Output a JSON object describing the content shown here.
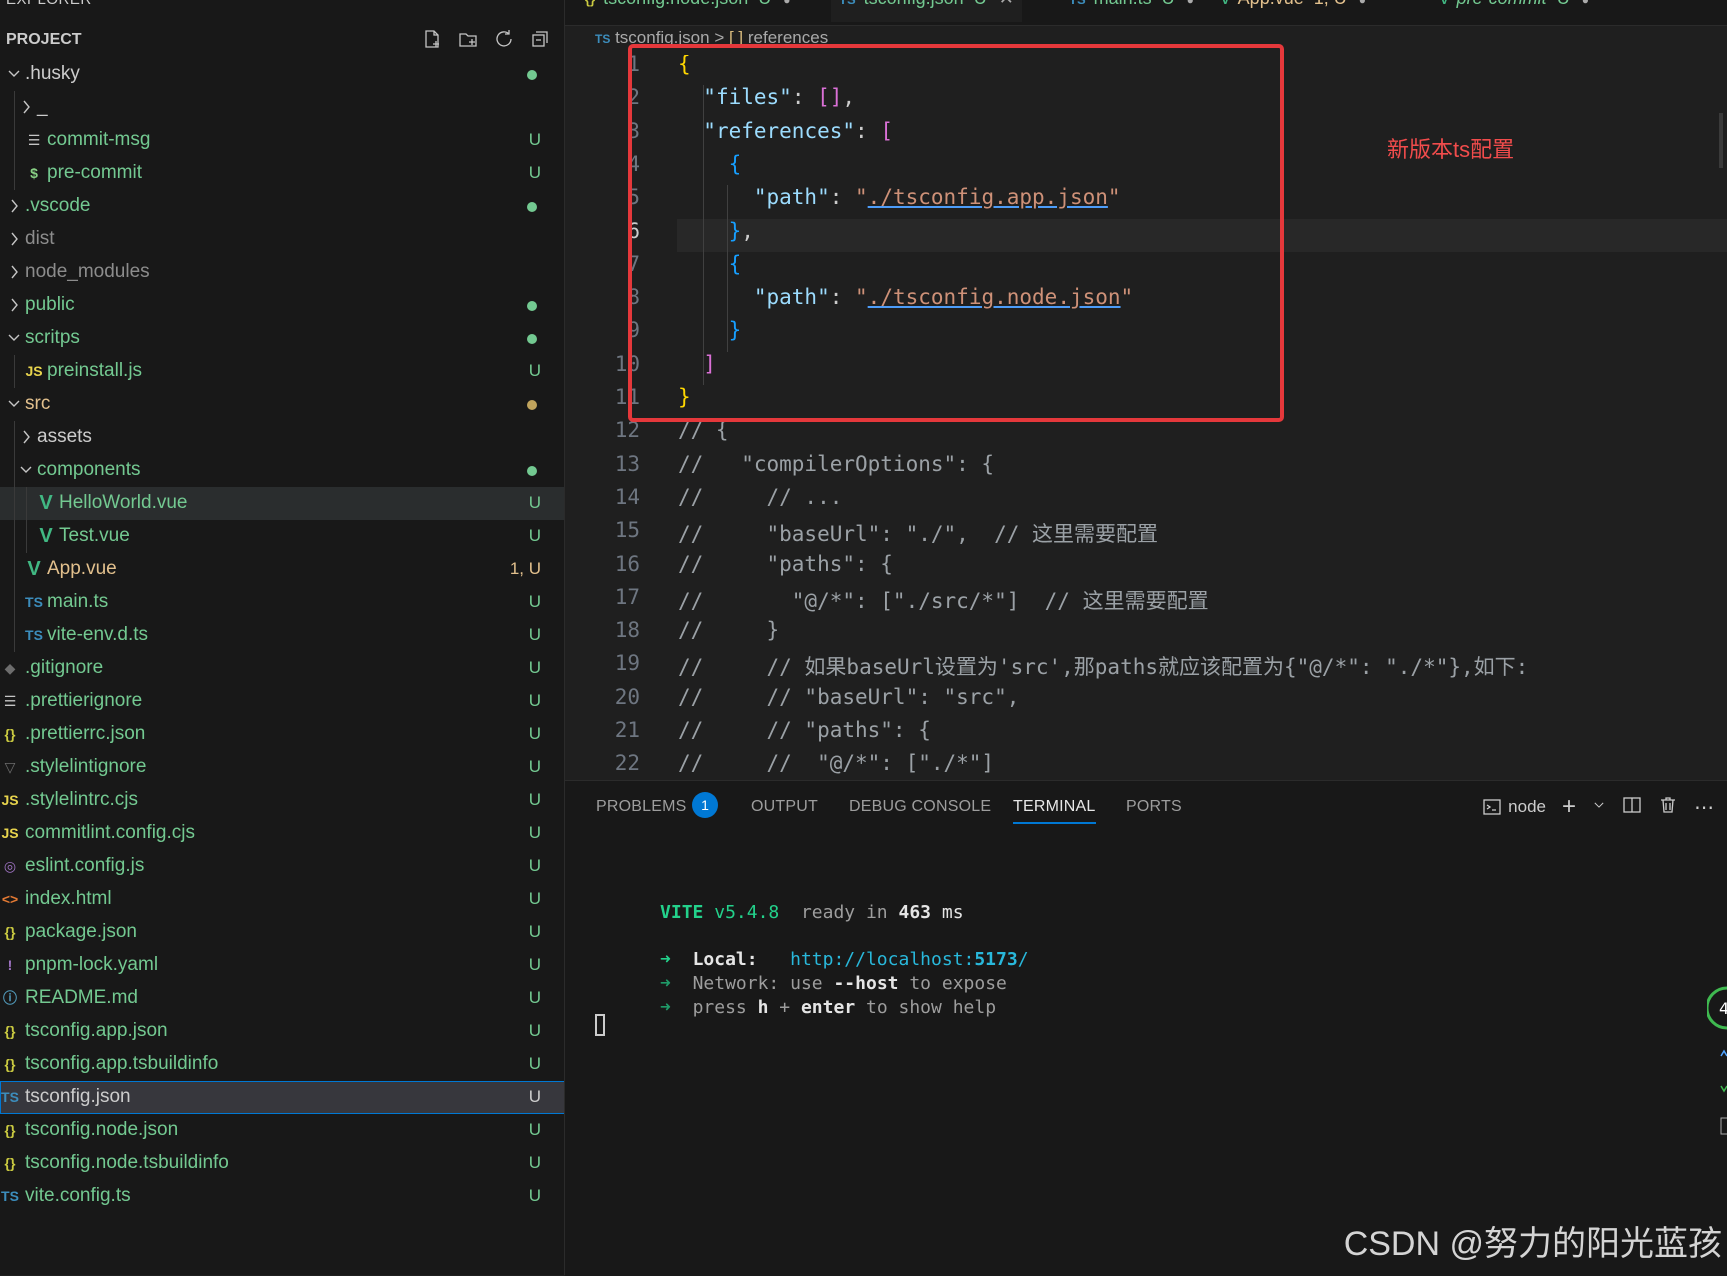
{
  "sidebar": {
    "section_title_cut": "EXPLORER",
    "project_title": "PROJECT",
    "actions": [
      "new-file",
      "new-folder",
      "refresh",
      "collapse-all"
    ],
    "tree": [
      {
        "label": ".husky",
        "kind": "folder-open",
        "depth": 0,
        "status": "",
        "dot": "#73c991",
        "color": "#cccccc"
      },
      {
        "label": "_",
        "kind": "folder-closed",
        "depth": 1,
        "status": "",
        "dot": "",
        "color": "#cccccc"
      },
      {
        "label": "commit-msg",
        "kind": "file-lines",
        "depth": 1,
        "status": "U",
        "color": "#73c991"
      },
      {
        "label": "pre-commit",
        "kind": "file-dollar",
        "depth": 1,
        "status": "U",
        "color": "#73c991"
      },
      {
        "label": ".vscode",
        "kind": "folder-closed",
        "depth": 0,
        "status": "",
        "dot": "#73c991",
        "color": "#73c991"
      },
      {
        "label": "dist",
        "kind": "folder-closed",
        "depth": 0,
        "status": "",
        "dot": "",
        "color": "#8c8c8c"
      },
      {
        "label": "node_modules",
        "kind": "folder-closed",
        "depth": 0,
        "status": "",
        "dot": "",
        "color": "#8c8c8c"
      },
      {
        "label": "public",
        "kind": "folder-closed",
        "depth": 0,
        "status": "",
        "dot": "#73c991",
        "color": "#73c991"
      },
      {
        "label": "scritps",
        "kind": "folder-open",
        "depth": 0,
        "status": "",
        "dot": "#73c991",
        "color": "#73c991"
      },
      {
        "label": "preinstall.js",
        "kind": "file-js",
        "depth": 1,
        "status": "U",
        "color": "#73c991"
      },
      {
        "label": "src",
        "kind": "folder-open",
        "depth": 0,
        "status": "",
        "dot": "#c1a45d",
        "color": "#e2c08d"
      },
      {
        "label": "assets",
        "kind": "folder-closed",
        "depth": 1,
        "status": "",
        "dot": "",
        "color": "#cccccc"
      },
      {
        "label": "components",
        "kind": "folder-open",
        "depth": 1,
        "status": "",
        "dot": "#73c991",
        "color": "#73c991"
      },
      {
        "label": "HelloWorld.vue",
        "kind": "file-vue",
        "depth": 2,
        "status": "U",
        "color": "#73c991",
        "hover": true
      },
      {
        "label": "Test.vue",
        "kind": "file-vue",
        "depth": 2,
        "status": "U",
        "color": "#73c991"
      },
      {
        "label": "App.vue",
        "kind": "file-vue",
        "depth": 1,
        "status": "1, U",
        "color": "#e2c08d"
      },
      {
        "label": "main.ts",
        "kind": "file-ts",
        "depth": 1,
        "status": "U",
        "color": "#73c991"
      },
      {
        "label": "vite-env.d.ts",
        "kind": "file-ts",
        "depth": 1,
        "status": "U",
        "color": "#73c991"
      },
      {
        "label": ".gitignore",
        "kind": "file-git",
        "depth": 0,
        "status": "U",
        "color": "#73c991"
      },
      {
        "label": ".prettierignore",
        "kind": "file-lines",
        "depth": 0,
        "status": "U",
        "color": "#73c991"
      },
      {
        "label": ".prettierrc.json",
        "kind": "file-json",
        "depth": 0,
        "status": "U",
        "color": "#73c991"
      },
      {
        "label": ".stylelintignore",
        "kind": "file-stylelint",
        "depth": 0,
        "status": "U",
        "color": "#73c991"
      },
      {
        "label": ".stylelintrc.cjs",
        "kind": "file-js",
        "depth": 0,
        "status": "U",
        "color": "#73c991"
      },
      {
        "label": "commitlint.config.cjs",
        "kind": "file-js",
        "depth": 0,
        "status": "U",
        "color": "#73c991"
      },
      {
        "label": "eslint.config.js",
        "kind": "file-eslint",
        "depth": 0,
        "status": "U",
        "color": "#73c991"
      },
      {
        "label": "index.html",
        "kind": "file-html",
        "depth": 0,
        "status": "U",
        "color": "#73c991"
      },
      {
        "label": "package.json",
        "kind": "file-json",
        "depth": 0,
        "status": "U",
        "color": "#73c991"
      },
      {
        "label": "pnpm-lock.yaml",
        "kind": "file-yaml",
        "depth": 0,
        "status": "U",
        "color": "#73c991"
      },
      {
        "label": "README.md",
        "kind": "file-info",
        "depth": 0,
        "status": "U",
        "color": "#73c991"
      },
      {
        "label": "tsconfig.app.json",
        "kind": "file-json",
        "depth": 0,
        "status": "U",
        "color": "#73c991"
      },
      {
        "label": "tsconfig.app.tsbuildinfo",
        "kind": "file-json",
        "depth": 0,
        "status": "U",
        "color": "#73c991"
      },
      {
        "label": "tsconfig.json",
        "kind": "file-tsconfig",
        "depth": 0,
        "status": "U",
        "color": "#cccccc",
        "selected": true
      },
      {
        "label": "tsconfig.node.json",
        "kind": "file-json",
        "depth": 0,
        "status": "U",
        "color": "#73c991"
      },
      {
        "label": "tsconfig.node.tsbuildinfo",
        "kind": "file-json",
        "depth": 0,
        "status": "U",
        "color": "#73c991"
      },
      {
        "label": "vite.config.ts",
        "kind": "file-ts",
        "depth": 0,
        "status": "U",
        "color": "#73c991"
      }
    ]
  },
  "tabs": [
    {
      "label": "tsconfig.node.json",
      "badge": "U",
      "icon": "{}",
      "active": false,
      "italic": false
    },
    {
      "label": "tsconfig.json",
      "badge": "U",
      "icon": "TS",
      "active": true,
      "italic": false
    },
    {
      "label": "main.ts",
      "badge": "U",
      "icon": "TS",
      "active": false,
      "italic": false
    },
    {
      "label": "App.vue",
      "badge": "1, U",
      "icon": "V",
      "active": false,
      "italic": false
    },
    {
      "label": "pre-commit",
      "badge": "U",
      "icon": "V",
      "active": false,
      "italic": true
    }
  ],
  "breadcrumb": {
    "file": "tsconfig.json",
    "sep": ">",
    "symbol_icon": "[ ]",
    "symbol": "references"
  },
  "editor": {
    "active_line": 6,
    "annotation": "新版本ts配置",
    "lines": [
      {
        "n": 1,
        "html": "<span class='p1'>{</span>"
      },
      {
        "n": 2,
        "html": "  <span class='k'>\"files\"</span>: <span class='p2'>[]</span>,"
      },
      {
        "n": 3,
        "html": "  <span class='k'>\"references\"</span>: <span class='p2'>[</span>"
      },
      {
        "n": 4,
        "html": "    <span class='p3'>{</span>"
      },
      {
        "n": 5,
        "html": "      <span class='k'>\"path\"</span>: <span class='s'>\"<span class='lnk'>./tsconfig.app.json</span>\"</span>"
      },
      {
        "n": 6,
        "html": "    <span class='p3'>}</span>,"
      },
      {
        "n": 7,
        "html": "    <span class='p3'>{</span>"
      },
      {
        "n": 8,
        "html": "      <span class='k'>\"path\"</span>: <span class='s'>\"<span class='lnk'>./tsconfig.node.json</span>\"</span>"
      },
      {
        "n": 9,
        "html": "    <span class='p3'>}</span>"
      },
      {
        "n": 10,
        "html": "  <span class='p2'>]</span>"
      },
      {
        "n": 11,
        "html": "<span class='p1'>}</span>"
      },
      {
        "n": 12,
        "html": "<span class='cm'>// {</span>"
      },
      {
        "n": 13,
        "html": "<span class='cm'>//   \"compilerOptions\": {</span>"
      },
      {
        "n": 14,
        "html": "<span class='cm'>//     // ...</span>"
      },
      {
        "n": 15,
        "html": "<span class='cm'>//     \"baseUrl\": \"./\",  // 这里需要配置</span>"
      },
      {
        "n": 16,
        "html": "<span class='cm'>//     \"paths\": {</span>"
      },
      {
        "n": 17,
        "html": "<span class='cm'>//       \"@/*\": [\"./src/*\"]  // 这里需要配置</span>"
      },
      {
        "n": 18,
        "html": "<span class='cm'>//     }</span>"
      },
      {
        "n": 19,
        "html": "<span class='cm'>//     // 如果baseUrl设置为'src',那paths就应该配置为{\"@/*\": \"./*\"},如下:</span>"
      },
      {
        "n": 20,
        "html": "<span class='cm'>//     // \"baseUrl\": \"src\",</span>"
      },
      {
        "n": 21,
        "html": "<span class='cm'>//     // \"paths\": {</span>"
      },
      {
        "n": 22,
        "html": "<span class='cm'>//     //  \"@/*\": [\"./*\"]</span>"
      }
    ]
  },
  "panel": {
    "tabs": [
      "PROBLEMS",
      "OUTPUT",
      "DEBUG CONSOLE",
      "TERMINAL",
      "PORTS"
    ],
    "active_tab": "TERMINAL",
    "problems_count": "1",
    "terminal_name": "node",
    "terminal": {
      "vite": "VITE",
      "version": "v5.4.8",
      "ready": "ready in",
      "ms_value": "463",
      "ms_unit": "ms",
      "local_label": "Local:",
      "local_url_prefix": "http://localhost:",
      "local_port": "5173",
      "local_url_suffix": "/",
      "network_label": "Network:",
      "network_text_a": "use",
      "network_flag": "--host",
      "network_text_b": "to expose",
      "help_a": "press",
      "help_h": "h",
      "help_plus": "+",
      "help_enter": "enter",
      "help_b": "to show help",
      "arrow": "➜"
    }
  },
  "watermark": "CSDN @努力的阳光蓝孩"
}
